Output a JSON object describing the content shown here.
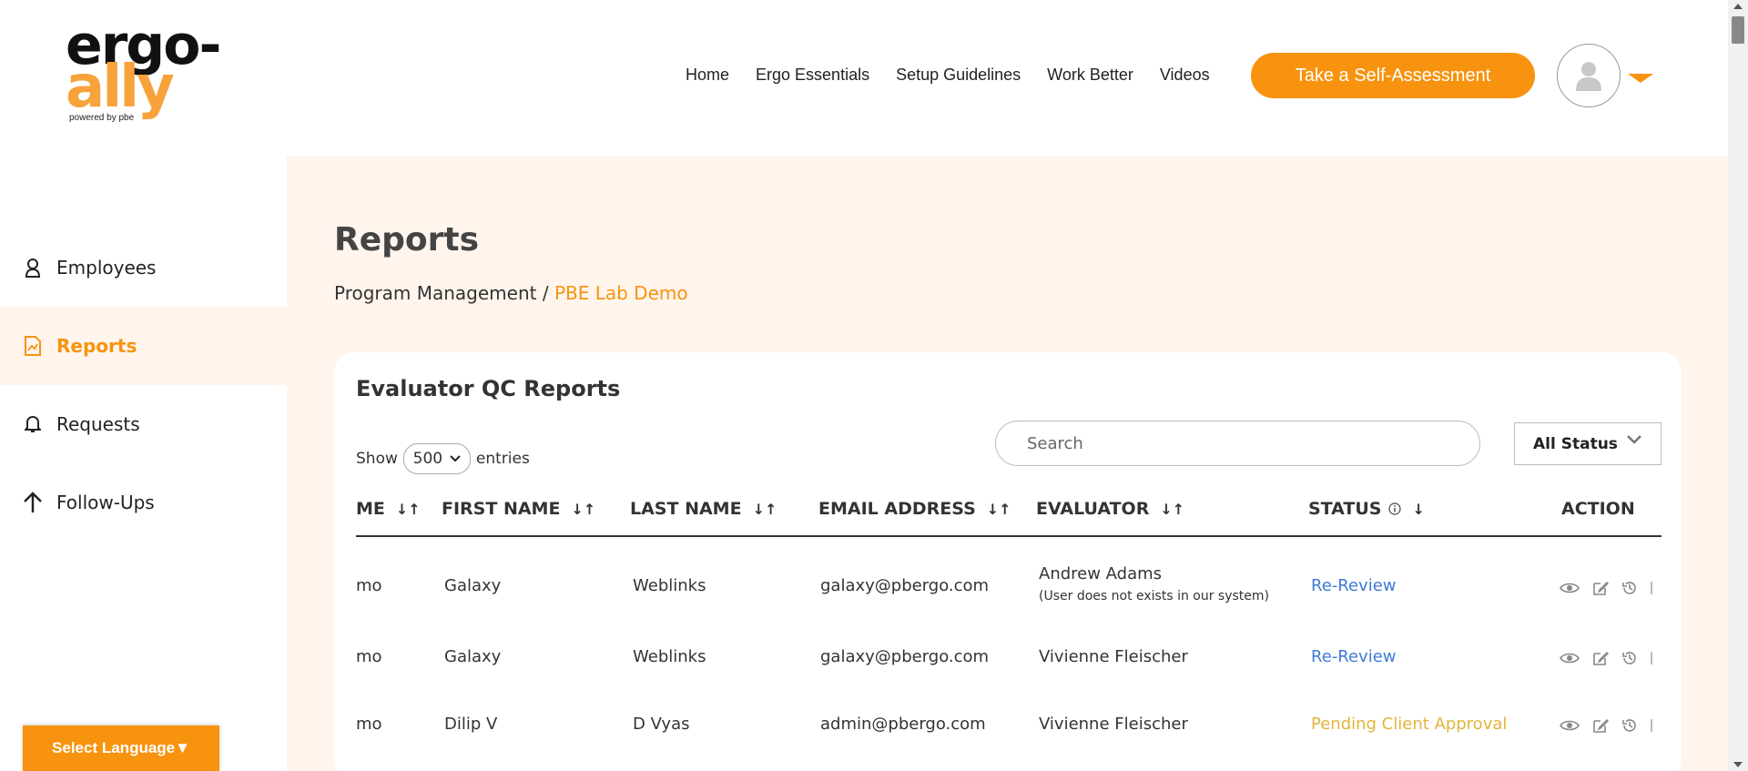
{
  "header": {
    "logo": {
      "line1": "ergo-",
      "line2": "ally",
      "tagline": "powered by pbe"
    },
    "nav": [
      {
        "label": "Home"
      },
      {
        "label": "Ergo Essentials"
      },
      {
        "label": "Setup Guidelines"
      },
      {
        "label": "Work Better"
      },
      {
        "label": "Videos"
      }
    ],
    "cta_label": "Take a Self-Assessment",
    "avatar_icon": "user-avatar-icon",
    "accent_color": "#f7930f"
  },
  "sidebar": {
    "items": [
      {
        "label": "Employees",
        "icon": "user-icon",
        "active": false
      },
      {
        "label": "Reports",
        "icon": "report-icon",
        "active": true
      },
      {
        "label": "Requests",
        "icon": "bell-icon",
        "active": false
      },
      {
        "label": "Follow-Ups",
        "icon": "arrow-up-icon",
        "active": false
      }
    ],
    "language_button": "Select Language▼"
  },
  "main": {
    "title": "Reports",
    "breadcrumb": {
      "parent": "Program Management / ",
      "current": "PBE Lab Demo"
    },
    "card": {
      "title": "Evaluator QC Reports",
      "show_label": "Show",
      "entries_value": "500",
      "entries_label": "entries",
      "search_placeholder": "Search",
      "status_filter": "All Status",
      "columns": [
        "ME",
        "FIRST NAME",
        "LAST NAME",
        "EMAIL ADDRESS",
        "EVALUATOR",
        "STATUS",
        "ACTION"
      ],
      "rows": [
        {
          "c0": "mo",
          "first": "Galaxy",
          "last": "Weblinks",
          "email": "galaxy@pbergo.com",
          "evaluator": "Andrew Adams",
          "evaluator_note": "(User does not exists in our system)",
          "status": "Re-Review"
        },
        {
          "c0": "mo",
          "first": "Galaxy",
          "last": "Weblinks",
          "email": "galaxy@pbergo.com",
          "evaluator": "Vivienne Fleischer",
          "evaluator_note": "",
          "status": "Re-Review"
        },
        {
          "c0": "mo",
          "first": "Dilip V",
          "last": "D Vyas",
          "email": "admin@pbergo.com",
          "evaluator": "Vivienne Fleischer",
          "evaluator_note": "",
          "status": "Pending Client Approval"
        }
      ]
    }
  }
}
